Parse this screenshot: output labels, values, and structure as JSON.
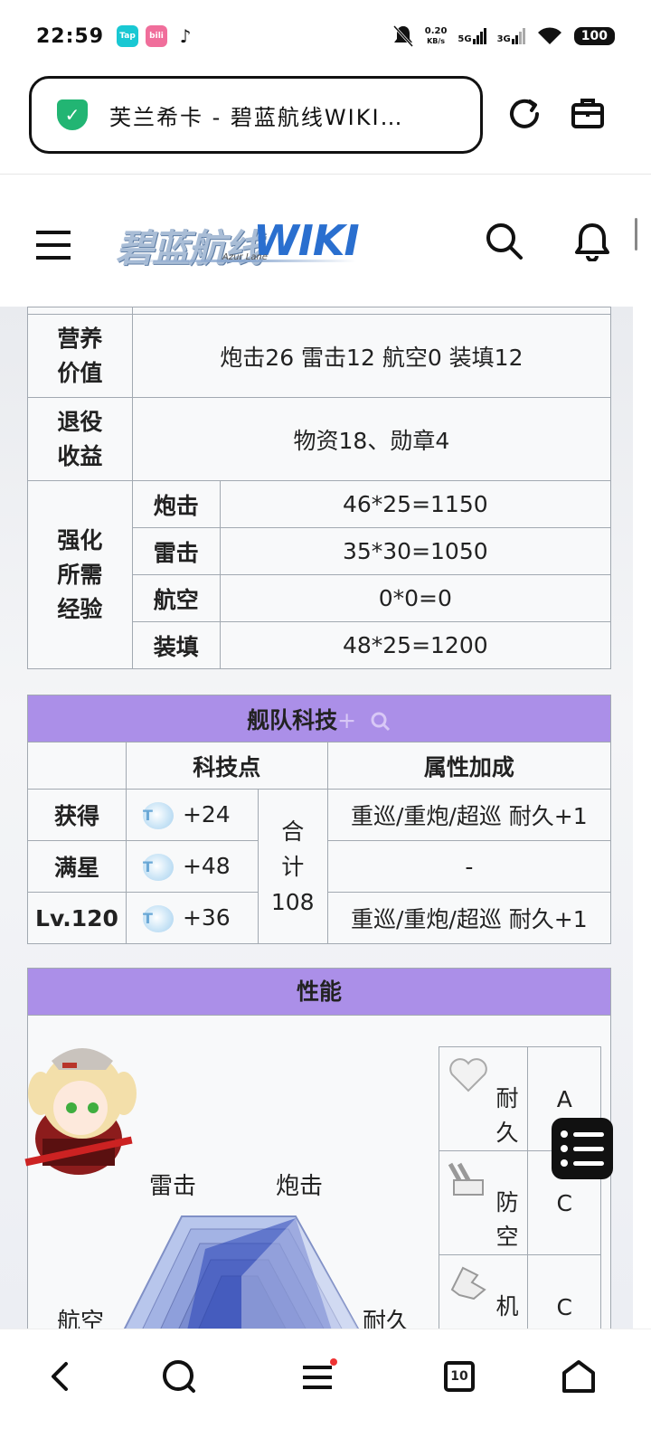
{
  "status_bar": {
    "time": "22:59",
    "apps": [
      {
        "name": "taptap-icon",
        "label": "Tap",
        "color": "#19c8d3"
      },
      {
        "name": "bilibili-icon",
        "label": "bili",
        "color": "#f06e9b"
      },
      {
        "name": "tiktok-icon",
        "label": "♪",
        "color": "#111111"
      }
    ],
    "net_speed_value": "0.20",
    "net_speed_unit": "KB/s",
    "sim1": "5G",
    "sim2": "3G",
    "battery": "100"
  },
  "browser": {
    "url_title": "芙兰希卡 - 碧蓝航线WIKI…",
    "shield_glyph": "✓",
    "reload_icon": "reload-icon",
    "toolbox_icon": "toolbox-icon"
  },
  "site": {
    "logo_cn": "碧蓝航线",
    "logo_en": "WIKI",
    "logo_sub": "Azur Lane"
  },
  "stats_table": {
    "nutrition_label": "营养\n价值",
    "nutrition_value": "炮击26 雷击12 航空0 装填12",
    "retire_label": "退役\n收益",
    "retire_value": "物资18、勋章4",
    "exp_label": "强化\n所需\n经验",
    "exp_rows": [
      {
        "stat": "炮击",
        "value": "46*25=1150"
      },
      {
        "stat": "雷击",
        "value": "35*30=1050"
      },
      {
        "stat": "航空",
        "value": "0*0=0"
      },
      {
        "stat": "装填",
        "value": "48*25=1200"
      }
    ]
  },
  "tech_table": {
    "title": "舰队科技",
    "title_extra": "+",
    "col_points": "科技点",
    "col_bonus": "属性加成",
    "total_label": "合\n计\n108",
    "rows": [
      {
        "label": "获得",
        "points": "+24",
        "bonus": "重巡/重炮/超巡 耐久+1"
      },
      {
        "label": "满星",
        "points": "+48",
        "bonus": "-"
      },
      {
        "label": "Lv.120",
        "points": "+36",
        "bonus": "重巡/重炮/超巡 耐久+1"
      }
    ],
    "tech_icon_glyph": "T"
  },
  "performance": {
    "title": "性能",
    "radar_labels": {
      "torpedo": "雷击",
      "firepower": "炮击",
      "aviation": "航空",
      "durability": "耐久"
    },
    "stats": [
      {
        "name": "耐\n久",
        "icon": "heart-icon",
        "grade": "A"
      },
      {
        "name": "防\n空",
        "icon": "anti-air-icon",
        "grade": "C"
      },
      {
        "name": "机\n动",
        "icon": "evasion-icon",
        "grade": "C"
      }
    ]
  },
  "bottom_nav": {
    "tabs_count": "10"
  }
}
